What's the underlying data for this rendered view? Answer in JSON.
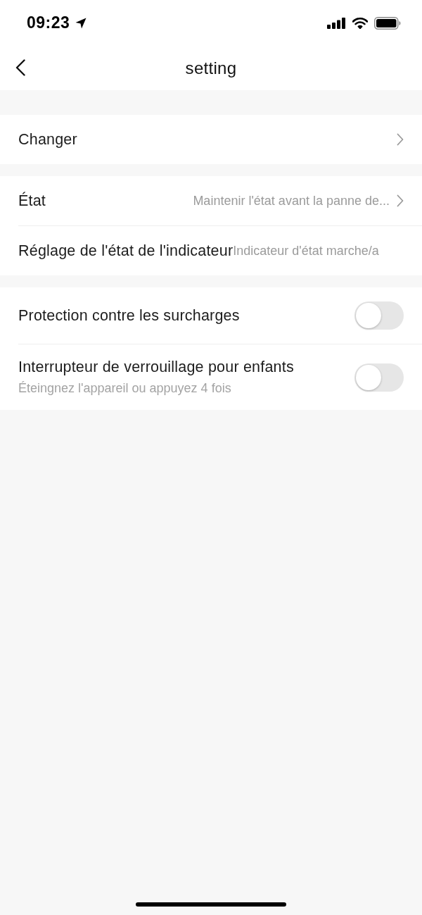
{
  "status_bar": {
    "time": "09:23"
  },
  "nav": {
    "title": "setting"
  },
  "groups": [
    {
      "rows": [
        {
          "kind": "link",
          "label": "Changer"
        }
      ]
    },
    {
      "rows": [
        {
          "kind": "link",
          "label": "État",
          "value": "Maintenir l'état avant la panne de..."
        },
        {
          "kind": "info",
          "label": "Réglage de l'état de l'indicateur",
          "value": "Indicateur d'état marche/a"
        }
      ]
    },
    {
      "rows": [
        {
          "kind": "toggle",
          "label": "Protection contre les surcharges",
          "on": false
        },
        {
          "kind": "toggle",
          "label": "Interrupteur de verrouillage pour enfants",
          "subtitle": "Éteingnez l'appareil ou appuyez 4 fois",
          "on": false
        }
      ]
    }
  ]
}
